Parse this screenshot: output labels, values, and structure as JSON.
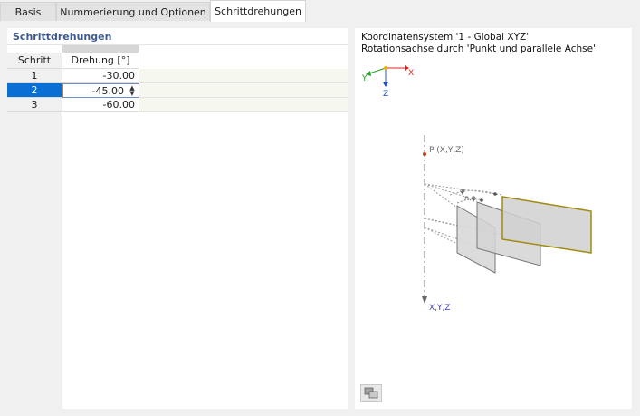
{
  "tabs": [
    {
      "label": "Basis",
      "active": false
    },
    {
      "label": "Nummerierung und Optionen",
      "active": false
    },
    {
      "label": "Schrittdrehungen",
      "active": true
    }
  ],
  "section": {
    "title": "Schrittdrehungen"
  },
  "table": {
    "headers": {
      "step": "Schritt",
      "rotation": "Drehung [°]"
    },
    "rows": [
      {
        "step": "1",
        "rotation": "-30.00"
      },
      {
        "step": "2",
        "rotation": "-45.00"
      },
      {
        "step": "3",
        "rotation": "-60.00"
      }
    ],
    "selected_row": 2
  },
  "info": {
    "coord_system": "Koordinatensystem '1 - Global XYZ'",
    "rotation_axis": "Rotationsachse durch 'Punkt und parallele Achse'"
  },
  "diagram": {
    "axis_x": "X",
    "axis_y": "Y",
    "axis_z": "Z",
    "point_label": "P (X,Y,Z)",
    "axis_label": "X,Y,Z",
    "phi_label": "φ",
    "nphi_label": "n.φ",
    "colors": {
      "axis_x": "#e02020",
      "axis_y": "#20a020",
      "axis_z": "#2050d0",
      "plate_outline": "#a08a10",
      "plate_fill": "#d8d8d8"
    }
  },
  "icons": {
    "bottom_button": "view-options-icon",
    "spin": "spin-updown-icon"
  }
}
